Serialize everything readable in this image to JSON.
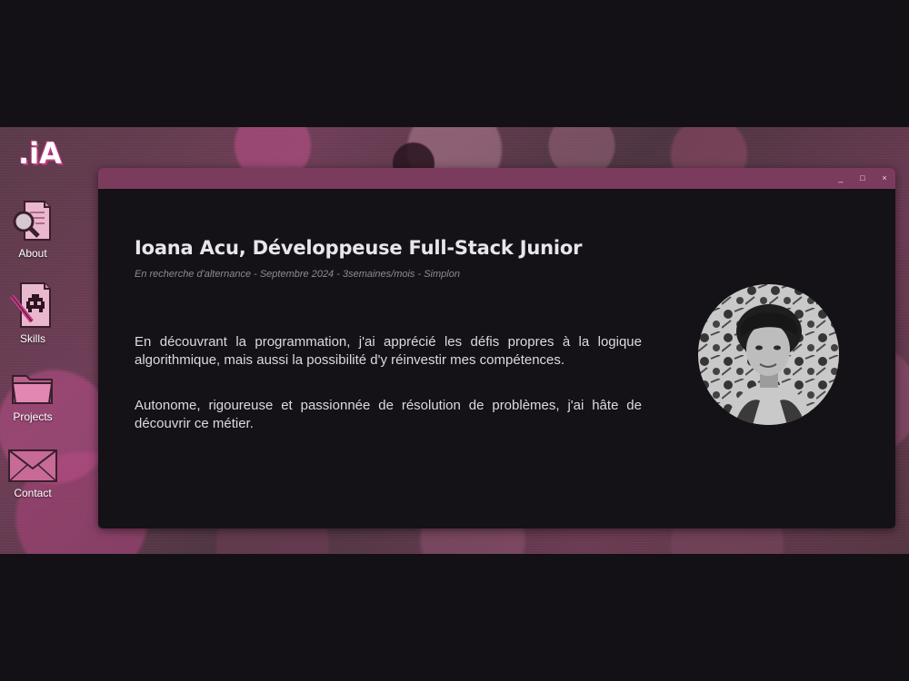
{
  "logo": ".iA",
  "desktop_icons": [
    {
      "label": "About",
      "icon": "document-magnifier-icon"
    },
    {
      "label": "Skills",
      "icon": "space-invader-document-icon"
    },
    {
      "label": "Projects",
      "icon": "folder-icon"
    },
    {
      "label": "Contact",
      "icon": "envelope-icon"
    }
  ],
  "window": {
    "controls": {
      "minimize": "_",
      "maximize": "□",
      "close": "×"
    },
    "title": "Ioana Acu, Développeuse Full-Stack Junior",
    "subtitle": "En recherche d'alternance - Septembre 2024 - 3semaines/mois - Simplon",
    "paragraphs": [
      "En découvrant la programmation, j'ai apprécié les défis propres à la logique algorithmique, mais aussi la possibilité d'y réinvestir mes compétences.",
      "Autonome, rigoureuse et passionnée de résolution de problèmes, j'ai hâte de découvrir ce métier."
    ]
  },
  "colors": {
    "page_background": "#131116",
    "titlebar": "#7b3b5d",
    "window_background": "#141217",
    "logo_accent": "#c23a85"
  }
}
